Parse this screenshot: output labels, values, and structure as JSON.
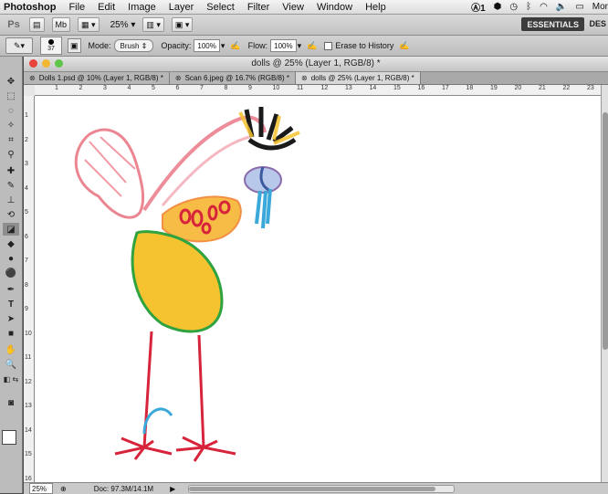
{
  "menubar": {
    "app": "Photoshop",
    "items": [
      "File",
      "Edit",
      "Image",
      "Layer",
      "Select",
      "Filter",
      "View",
      "Window",
      "Help"
    ],
    "status": {
      "adobe_badge": "1",
      "user": "Mor"
    }
  },
  "appbar": {
    "logo": "Ps",
    "mb_label": "Mb",
    "zoom": "25%",
    "workspace": "ESSENTIALS",
    "workspace2": "DES"
  },
  "options": {
    "brush_size": "37",
    "mode_label": "Mode:",
    "mode_value": "Brush",
    "opacity_label": "Opacity:",
    "opacity_value": "100%",
    "flow_label": "Flow:",
    "flow_value": "100%",
    "erase_label": "Erase to History"
  },
  "document": {
    "title": "dolls @ 25% (Layer 1, RGB/8) *",
    "tabs": [
      {
        "label": "Dolls 1.psd @ 10% (Layer 1, RGB/8) *"
      },
      {
        "label": "Scan 6.jpeg @ 16.7% (RGB/8) *"
      },
      {
        "label": "dolls @ 25% (Layer 1, RGB/8) *"
      }
    ],
    "ruler_h": [
      "1",
      "2",
      "3",
      "4",
      "5",
      "6",
      "7",
      "8",
      "9",
      "10",
      "11",
      "12",
      "13",
      "14",
      "15",
      "16",
      "17",
      "18",
      "19",
      "20",
      "21",
      "22",
      "23"
    ],
    "ruler_v": [
      "1",
      "2",
      "3",
      "4",
      "5",
      "6",
      "7",
      "8",
      "9",
      "10",
      "11",
      "12",
      "13",
      "14",
      "15",
      "16"
    ]
  },
  "status": {
    "zoom": "25%",
    "doc": "Doc: 97.3M/14.1M"
  },
  "colors": {
    "pink": "#e8707f",
    "yellow": "#f5c330",
    "green": "#2ea33f",
    "red": "#d8243a",
    "blue": "#3aa8d8",
    "black": "#1a1a1a"
  }
}
